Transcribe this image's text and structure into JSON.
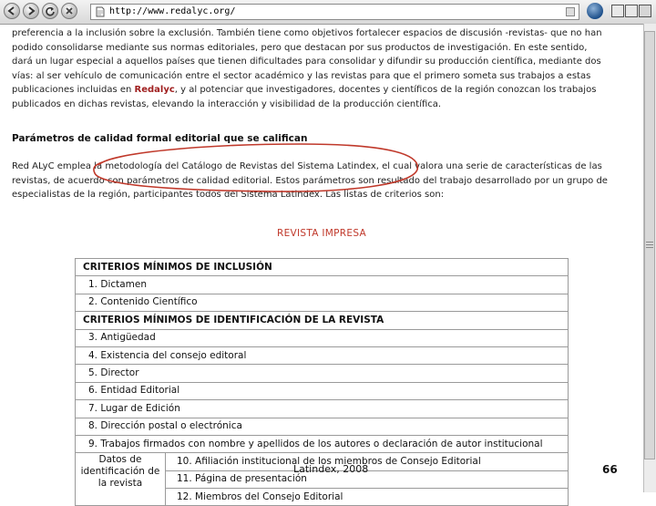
{
  "browser": {
    "url": "http://www.redalyc.org/"
  },
  "intro_lines": [
    "preferencia a la inclusión sobre la exclusión. También tiene como objetivos fortalecer espacios de discusión -revistas- que no han",
    "podido consolidarse mediante sus normas editoriales, pero que destacan por sus productos de investigación. En este sentido,",
    "dará un lugar especial a aquellos países que tienen dificultades para consolidar y difundir su producción científica, mediante dos",
    "vías: al ser vehículo de comunicación entre el sector académico y las revistas para que el primero someta sus trabajos a estas",
    {
      "before": "publicaciones incluidas en ",
      "brand": "Redalyc",
      "after": ", y al potenciar que investigadores, docentes y científicos de la región conozcan los trabajos"
    },
    "publicados en dichas revistas, elevando la interacción y visibilidad de la producción científica."
  ],
  "section_heading": "Parámetros de calidad formal editorial que se califican",
  "method_lines": [
    "Red ALyC emplea la metodología del Catálogo de Revistas del Sistema Latindex, el cual valora una serie de características de las",
    "revistas, de acuerdo con parámetros de calidad editorial. Estos parámetros son resultado del trabajo desarrollado por un grupo de",
    "especialistas de la región, participantes todos del Sistema Latindex. Las listas de criterios son:"
  ],
  "subtitle": "REVISTA IMPRESA",
  "table": {
    "header1": "CRITERIOS MÍNIMOS DE INCLUSIÓN",
    "group1": [
      "1. Dictamen",
      "2. Contenido Científico"
    ],
    "header2": "CRITERIOS MÍNIMOS DE IDENTIFICACIÓN DE LA REVISTA",
    "group2": [
      "3. Antigüedad",
      "4. Existencia del consejo editoral",
      "5. Director",
      "6. Entidad Editorial",
      "7. Lugar de Edición",
      "8. Dirección postal o electrónica",
      "9. Trabajos firmados con nombre y apellidos de los autores o declaración de autor institucional"
    ],
    "row_label": "Datos de identificación de la revista",
    "sub_items": [
      "10. Afiliación institucional de los miembros de Consejo Editorial",
      "11. Página de presentación",
      "12. Miembros del Consejo Editorial"
    ]
  },
  "footer": "Latindex, 2008",
  "page_number": "66",
  "colors": {
    "brand_red": "#a02020",
    "subtitle_red": "#c0392b",
    "annotation_ellipse": "#c0392b"
  },
  "icons": [
    "back-arrow-icon",
    "forward-arrow-icon",
    "reload-icon",
    "stop-icon",
    "home-icon",
    "page-icon",
    "throbber-icon"
  ]
}
